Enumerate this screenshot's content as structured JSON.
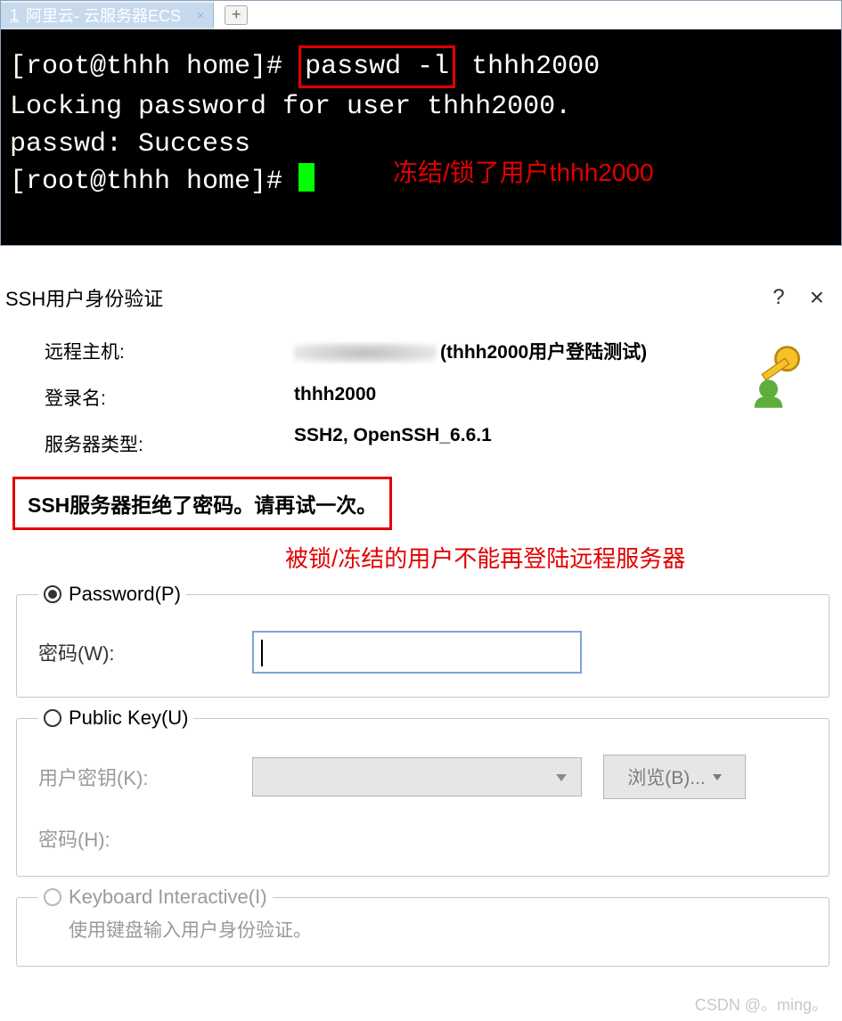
{
  "terminal": {
    "tab_number": "1",
    "tab_title": "阿里云- 云服务器ECS",
    "prompt1": "[root@thhh home]# ",
    "cmd_boxed": "passwd -l",
    "cmd_rest": " thhh2000",
    "out1": "Locking password for user thhh2000.",
    "out2": "passwd: Success",
    "prompt2": "[root@thhh home]# ",
    "annotation": "冻结/锁了用户thhh2000"
  },
  "dialog": {
    "title": "SSH用户身份验证",
    "help": "?",
    "close": "×",
    "labels": {
      "remote_host": "远程主机:",
      "login": "登录名:",
      "server_type": "服务器类型:"
    },
    "values": {
      "remote_host_suffix": "(thhh2000用户登陆测试)",
      "login": "thhh2000",
      "server_type": "SSH2, OpenSSH_6.6.1"
    },
    "error": "SSH服务器拒绝了密码。请再试一次。",
    "annotation2": "被锁/冻结的用户不能再登陆远程服务器",
    "methods": {
      "password": {
        "legend": "Password(P)",
        "pwd_label": "密码(W):"
      },
      "publickey": {
        "legend": "Public Key(U)",
        "key_label": "用户密钥(K):",
        "pwd_label": "密码(H):",
        "browse": "浏览(B)..."
      },
      "keyboard": {
        "legend": "Keyboard Interactive(I)",
        "desc": "使用键盘输入用户身份验证。"
      }
    }
  },
  "watermark": "CSDN @。ming。"
}
